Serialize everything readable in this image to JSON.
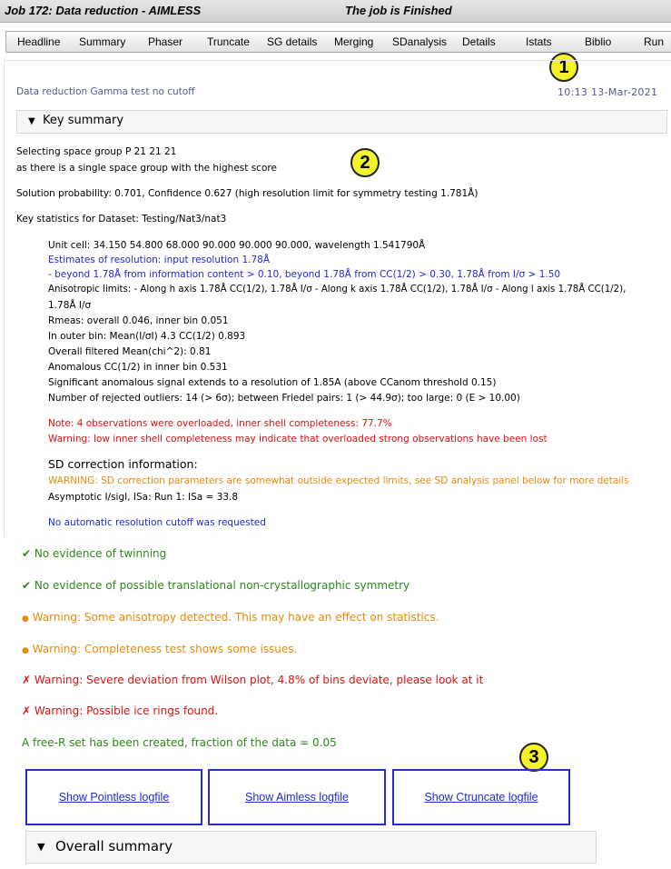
{
  "window": {
    "job_title": "Job 172:  Data reduction - AIMLESS",
    "status": "The job is Finished"
  },
  "tabs": [
    "Headline",
    "Summary",
    "Phaser",
    "Truncate",
    "SG details",
    "Merging",
    "SDanalysis",
    "Details",
    "Istats",
    "Biblio",
    "Run"
  ],
  "badges": [
    "1",
    "2",
    "3"
  ],
  "header": {
    "title": "Data reduction Gamma test no cutoff",
    "timestamp": "10:13 13-Mar-2021"
  },
  "key_summary": {
    "label": "Key summary",
    "space_group_line1": "Selecting space group P 21 21 21",
    "space_group_line2": "as there is a single space group with the highest score",
    "solution_probability": "Solution probability: 0.701, Confidence 0.627 (high resolution limit for symmetry testing 1.781Å)",
    "key_stats_title": "Key statistics for Dataset: Testing/Nat3/nat3",
    "stats": {
      "unit_cell": "Unit cell: 34.150 54.800 68.000 90.000 90.000 90.000, wavelength 1.541790Å",
      "resolution_estimate": "Estimates of resolution: input resolution 1.78Å",
      "resolution_detail": "- beyond 1.78Å from information content > 0.10, beyond 1.78Å from CC(1/2) > 0.30, 1.78Å from I/σ > 1.50",
      "anisotropic_1": "Anisotropic limits: - Along h axis 1.78Å CC(1/2), 1.78Å I/σ - Along k axis 1.78Å CC(1/2), 1.78Å I/σ - Along l axis 1.78Å CC(1/2),",
      "anisotropic_2": "1.78Å I/σ",
      "rmeas": "Rmeas: overall 0.046, inner bin 0.051",
      "outer_bin": "In outer bin: Mean(I/σI) 4.3 CC(1/2) 0.893",
      "chi2": "Overall filtered Mean(chi^2): 0.81",
      "anomalous_cc": "Anomalous CC(1/2) in inner bin 0.531",
      "anomalous_signal": "Significant anomalous signal extends to a resolution of 1.85A (above CCanom threshold 0.15)",
      "outliers": "Number of rejected outliers: 14 (> 6σ); between Friedel pairs: 1 (> 44.9σ); too large: 0 (E > 10.00)"
    },
    "note_overload": "Note: 4 observations were overloaded, inner shell completeness: 77.7%",
    "warning_completeness": "Warning: low inner shell completeness may indicate that overloaded strong observations have been lost",
    "sd_title": "SD correction information:",
    "sd_warning": "WARNING: SD correction parameters are somewhat outside expected limits, see SD analysis panel below for more details",
    "sd_isa": "Asymptotic I/sigI, ISa: Run 1: ISa = 33.8",
    "no_cutoff": "No automatic resolution cutoff was requested"
  },
  "checks": [
    {
      "icon": "✔",
      "text": "No evidence of twinning",
      "color": "#2b8a16"
    },
    {
      "icon": "✔",
      "text": "No evidence of possible translational non-crystallographic symmetry",
      "color": "#2b8a16"
    },
    {
      "icon": "●",
      "text": "Warning: Some anisotropy detected. This may have an effect on statistics.",
      "color": "#e98a08"
    },
    {
      "icon": "●",
      "text": "Warning: Completeness test shows some issues.",
      "color": "#e98a08"
    },
    {
      "icon": "✗",
      "text": "Warning: Severe deviation from Wilson plot, 4.8% of bins deviate, please look at it",
      "color": "#e01010"
    },
    {
      "icon": "✗",
      "text": "Warning: Possible ice rings found.",
      "color": "#e01010"
    }
  ],
  "free_r": "A free-R set has been created, fraction of the data = 0.05",
  "log_buttons": [
    "Show Pointless logfile",
    "Show Aimless logfile",
    "Show Ctruncate logfile"
  ],
  "overall_summary": {
    "label": "Overall summary"
  }
}
